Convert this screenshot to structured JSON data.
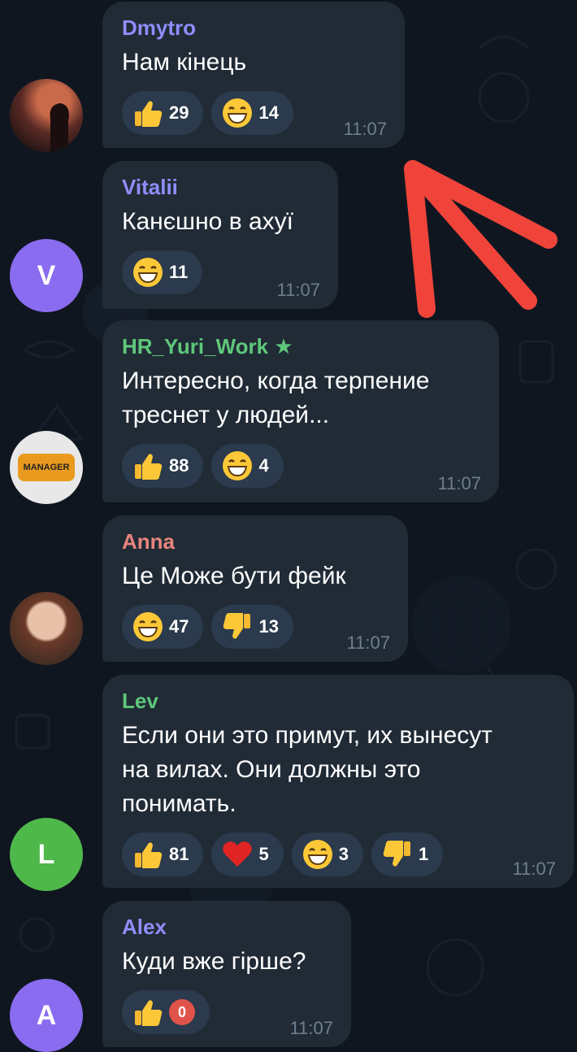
{
  "messages": [
    {
      "sender": "Dmytro",
      "sender_color": "#8f8dfb",
      "text_lines": [
        "Нам кінець"
      ],
      "reactions": [
        {
          "emoji": "thumbs-up",
          "count": "29"
        },
        {
          "emoji": "grin",
          "count": "14"
        }
      ],
      "time": "11:07",
      "avatar": {
        "type": "photo",
        "desc": "silhouette-sunset"
      }
    },
    {
      "sender": "Vitalii",
      "sender_color": "#8f8dfb",
      "text_lines": [
        "Канєшно в ахуї"
      ],
      "reactions": [
        {
          "emoji": "grin",
          "count": "11"
        }
      ],
      "time": "11:07",
      "avatar": {
        "type": "initial",
        "letter": "V",
        "color": "#8a6cf0"
      }
    },
    {
      "sender": "HR_Yuri_Work",
      "sender_color": "#5fc77a",
      "text_lines": [
        "Интересно, когда терпение",
        "треснет у людей..."
      ],
      "reactions": [
        {
          "emoji": "thumbs-up",
          "count": "88"
        },
        {
          "emoji": "grin",
          "count": "4"
        }
      ],
      "time": "11:07",
      "avatar": {
        "type": "logo",
        "label": "MANAGER"
      }
    },
    {
      "sender": "Anna",
      "sender_color": "#e8847c",
      "text_lines": [
        "Це Може бути фейк"
      ],
      "reactions": [
        {
          "emoji": "grin",
          "count": "47"
        },
        {
          "emoji": "thumbs-down",
          "count": "13"
        }
      ],
      "time": "11:07",
      "avatar": {
        "type": "photo",
        "desc": "woman-portrait"
      }
    },
    {
      "sender": "Lev",
      "sender_color": "#5fc77a",
      "text_lines": [
        "Если они это примут, их вынесут",
        "на вилах. Они должны это",
        "понимать."
      ],
      "reactions": [
        {
          "emoji": "thumbs-up",
          "count": "81"
        },
        {
          "emoji": "heart",
          "count": "5"
        },
        {
          "emoji": "grin",
          "count": "3"
        },
        {
          "emoji": "thumbs-down",
          "count": "1"
        }
      ],
      "time": "11:07",
      "avatar": {
        "type": "initial",
        "letter": "L",
        "color": "#4fb84a"
      }
    },
    {
      "sender": "Alex",
      "sender_color": "#8f8dfb",
      "text_lines": [
        "Куди вже гірше?"
      ],
      "reactions": [
        {
          "emoji": "thumbs-up",
          "count": ""
        }
      ],
      "time": "11:07",
      "avatar": {
        "type": "initial",
        "letter": "A",
        "color": "#8a6cf0"
      },
      "unread_badge": "0"
    }
  ],
  "accent": {
    "arrow": "#f0443a",
    "bubble": "#202b36",
    "reaction_pill": "#2b3a4c"
  }
}
